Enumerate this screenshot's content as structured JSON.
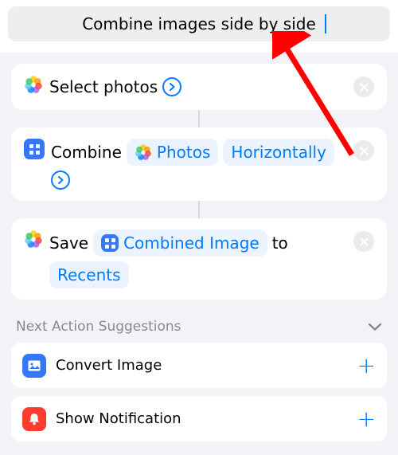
{
  "header": {
    "title_value": "Combine images side by side"
  },
  "actions": [
    {
      "kind": "select_photos",
      "primary_text": "Select photos"
    },
    {
      "kind": "combine",
      "prefix": "Combine",
      "token_photos": "Photos",
      "param_direction": "Horizontally"
    },
    {
      "kind": "save",
      "prefix": "Save",
      "token_result": "Combined Image",
      "mid_text": "to",
      "token_album": "Recents"
    }
  ],
  "suggestions": {
    "header": "Next Action Suggestions",
    "items": [
      {
        "label": "Convert Image",
        "icon": "image",
        "color": "blue"
      },
      {
        "label": "Show Notification",
        "icon": "bell",
        "color": "red"
      }
    ]
  }
}
